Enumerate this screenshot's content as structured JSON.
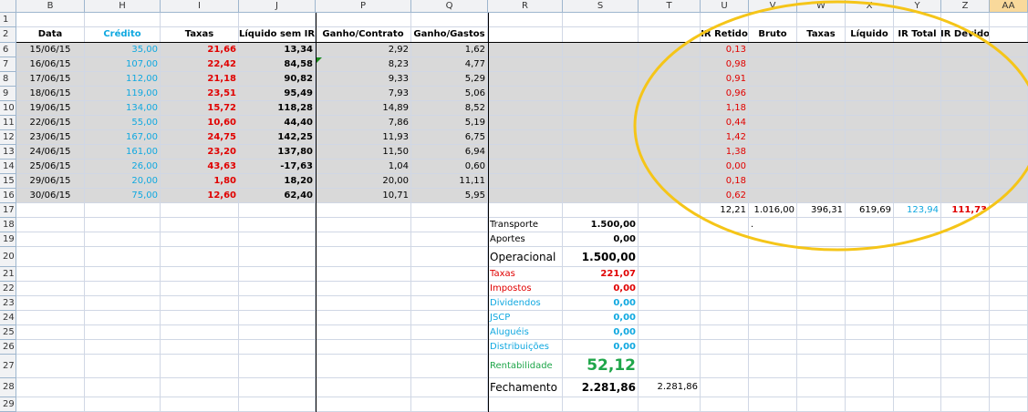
{
  "columns": [
    "B",
    "H",
    "I",
    "J",
    "P",
    "Q",
    "R",
    "S",
    "T",
    "U",
    "V",
    "W",
    "X",
    "Y",
    "Z",
    "AA"
  ],
  "selected_column": "AA",
  "row_numbers": [
    "1",
    "2",
    "6",
    "7",
    "8",
    "9",
    "10",
    "11",
    "12",
    "13",
    "14",
    "15",
    "16",
    "17",
    "18",
    "19",
    "20",
    "21",
    "22",
    "23",
    "24",
    "25",
    "26",
    "27",
    "28",
    "29"
  ],
  "headers": {
    "data": "Data",
    "credito": "Crédito",
    "taxas": "Taxas",
    "liquido_sem_ir": "Líquido sem IR",
    "ganho_contrato": "Ganho/Contrato",
    "ganho_gastos": "Ganho/Gastos",
    "ir_retido": "IR Retido",
    "bruto": "Bruto",
    "taxas2": "Taxas",
    "liquido": "Líquido",
    "ir_total": "IR Total",
    "ir_devido": "IR Devido"
  },
  "rows": [
    {
      "data": "15/06/15",
      "credito": "35,00",
      "taxas": "21,66",
      "liquido": "13,34",
      "contrato": "2,92",
      "gastos": "1,62",
      "ir": "0,13"
    },
    {
      "data": "16/06/15",
      "credito": "107,00",
      "taxas": "22,42",
      "liquido": "84,58",
      "contrato": "8,23",
      "gastos": "4,77",
      "ir": "0,98"
    },
    {
      "data": "17/06/15",
      "credito": "112,00",
      "taxas": "21,18",
      "liquido": "90,82",
      "contrato": "9,33",
      "gastos": "5,29",
      "ir": "0,91"
    },
    {
      "data": "18/06/15",
      "credito": "119,00",
      "taxas": "23,51",
      "liquido": "95,49",
      "contrato": "7,93",
      "gastos": "5,06",
      "ir": "0,96"
    },
    {
      "data": "19/06/15",
      "credito": "134,00",
      "taxas": "15,72",
      "liquido": "118,28",
      "contrato": "14,89",
      "gastos": "8,52",
      "ir": "1,18"
    },
    {
      "data": "22/06/15",
      "credito": "55,00",
      "taxas": "10,60",
      "liquido": "44,40",
      "contrato": "7,86",
      "gastos": "5,19",
      "ir": "0,44"
    },
    {
      "data": "23/06/15",
      "credito": "167,00",
      "taxas": "24,75",
      "liquido": "142,25",
      "contrato": "11,93",
      "gastos": "6,75",
      "ir": "1,42"
    },
    {
      "data": "24/06/15",
      "credito": "161,00",
      "taxas": "23,20",
      "liquido": "137,80",
      "contrato": "11,50",
      "gastos": "6,94",
      "ir": "1,38"
    },
    {
      "data": "25/06/15",
      "credito": "26,00",
      "taxas": "43,63",
      "liquido": "-17,63",
      "contrato": "1,04",
      "gastos": "0,60",
      "ir": "0,00"
    },
    {
      "data": "29/06/15",
      "credito": "20,00",
      "taxas": "1,80",
      "liquido": "18,20",
      "contrato": "20,00",
      "gastos": "11,11",
      "ir": "0,18"
    },
    {
      "data": "30/06/15",
      "credito": "75,00",
      "taxas": "12,60",
      "liquido": "62,40",
      "contrato": "10,71",
      "gastos": "5,95",
      "ir": "0,62"
    }
  ],
  "totals": {
    "ir_retido": "12,21",
    "bruto": "1.016,00",
    "taxas": "396,31",
    "liquido": "619,69",
    "ir_total": "123,94",
    "ir_devido": "111,73"
  },
  "summary": [
    {
      "label": "Transporte",
      "value": "1.500,00"
    },
    {
      "label": "Aportes",
      "value": "0,00"
    },
    {
      "label": "Operacional",
      "value": "1.500,00"
    },
    {
      "label": "Taxas",
      "value": "221,07"
    },
    {
      "label": "Impostos",
      "value": "0,00"
    },
    {
      "label": "Dividendos",
      "value": "0,00"
    },
    {
      "label": "JSCP",
      "value": "0,00"
    },
    {
      "label": "Aluguéis",
      "value": "0,00"
    },
    {
      "label": "Distribuições",
      "value": "0,00"
    },
    {
      "label": "Rentabilidade",
      "value": "52,12"
    },
    {
      "label": "Fechamento",
      "value": "2.281,86"
    }
  ],
  "fechamento_t": "2.281,86",
  "dot_mark": ".",
  "colors": {
    "red": "#e00000",
    "blue": "#10a8e0",
    "green": "#1fa64a",
    "gray_fill": "#d9d9d9",
    "annotation": "#f5c518"
  }
}
